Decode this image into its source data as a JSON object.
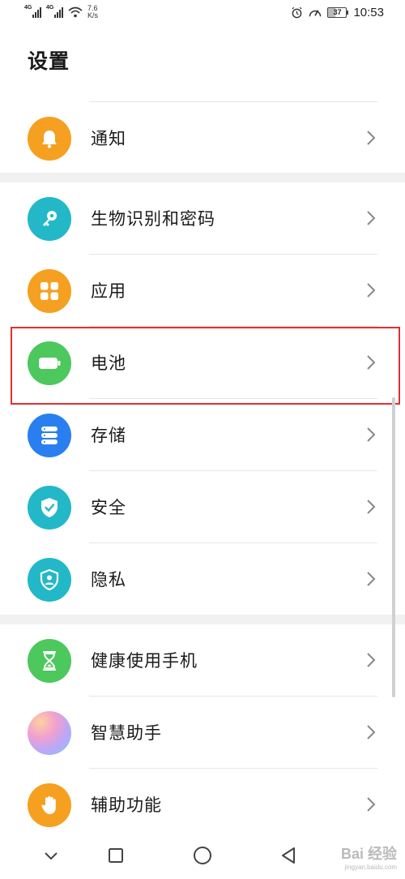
{
  "status_bar": {
    "sim1": "4G",
    "sim2": "4G",
    "speed_value": "7.6",
    "speed_unit": "K/s",
    "battery": "37",
    "time": "10:53"
  },
  "page_title": "设置",
  "items": [
    {
      "label": "通知",
      "icon": "bell-icon",
      "color": "#f5a020"
    },
    {
      "label": "生物识别和密码",
      "icon": "key-icon",
      "color": "#22b8c8"
    },
    {
      "label": "应用",
      "icon": "apps-grid-icon",
      "color": "#f5a020"
    },
    {
      "label": "电池",
      "icon": "battery-icon",
      "color": "#4cc85c"
    },
    {
      "label": "存储",
      "icon": "storage-icon",
      "color": "#2a7ff0"
    },
    {
      "label": "安全",
      "icon": "shield-check-icon",
      "color": "#22b8c8"
    },
    {
      "label": "隐私",
      "icon": "privacy-icon",
      "color": "#22b8c8"
    },
    {
      "label": "健康使用手机",
      "icon": "hourglass-icon",
      "color": "#4cc85c"
    },
    {
      "label": "智慧助手",
      "icon": "assistant-icon",
      "color": "#c8a0f0"
    },
    {
      "label": "辅助功能",
      "icon": "hand-icon",
      "color": "#f5a020"
    }
  ],
  "watermark": {
    "text": "Bai 经验",
    "sub": "jingyan.baidu.com"
  }
}
